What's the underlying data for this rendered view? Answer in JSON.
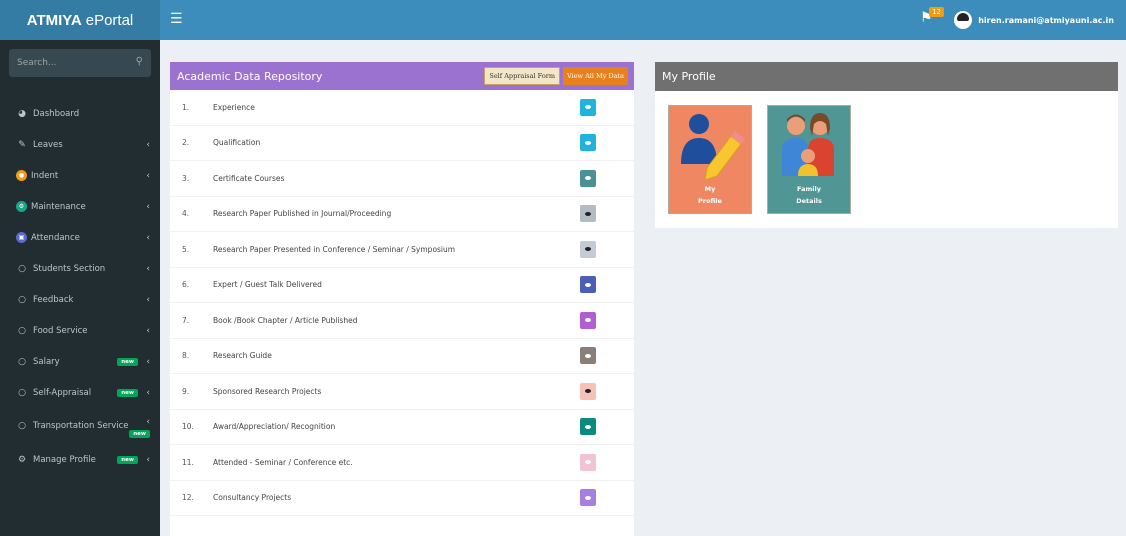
{
  "header": {
    "brand_bold": "ATMIYA",
    "brand_rest": "ePortal",
    "notification_count": "12",
    "user_email": "hiren.ramani@atmiyauni.ac.in"
  },
  "sidebar": {
    "search_placeholder": "Search...",
    "items": [
      {
        "label": "Dashboard",
        "icon": "dashboard-icon"
      },
      {
        "label": "Leaves",
        "icon": "edit-icon"
      },
      {
        "label": "Indent",
        "icon": "indent-icon"
      },
      {
        "label": "Maintenance",
        "icon": "maintenance-icon"
      },
      {
        "label": "Attendance",
        "icon": "attendance-icon"
      },
      {
        "label": "Students Section",
        "icon": "circle-icon"
      },
      {
        "label": "Feedback",
        "icon": "circle-icon"
      },
      {
        "label": "Food Service",
        "icon": "circle-icon"
      },
      {
        "label": "Salary",
        "icon": "circle-icon",
        "badge": "new"
      },
      {
        "label": "Self-Appraisal",
        "icon": "circle-icon",
        "badge": "new"
      },
      {
        "label": "Transportation Service",
        "icon": "circle-icon",
        "badge": "new"
      },
      {
        "label": "Manage Profile",
        "icon": "cogs-icon",
        "badge": "new"
      }
    ]
  },
  "academic": {
    "title": "Academic Data Repository",
    "self_appraisal_label": "Self Appraisal Form",
    "view_all_label": "View All My Data",
    "rows": [
      {
        "num": "1.",
        "label": "Experience",
        "color": "#1fb4e0"
      },
      {
        "num": "2.",
        "label": "Qualification",
        "color": "#1fb4e0"
      },
      {
        "num": "3.",
        "label": "Certificate Courses",
        "color": "#4a9095"
      },
      {
        "num": "4.",
        "label": "Research Paper Published in Journal/Proceeding",
        "color": "#b3bcc4"
      },
      {
        "num": "5.",
        "label": "Research Paper Presented in Conference / Seminar / Symposium",
        "color": "#c5cbd6"
      },
      {
        "num": "6.",
        "label": "Expert / Guest Talk Delivered",
        "color": "#4b5fb8"
      },
      {
        "num": "7.",
        "label": "Book /Book Chapter / Article Published",
        "color": "#b05fd3"
      },
      {
        "num": "8.",
        "label": "Research Guide",
        "color": "#8a7f78"
      },
      {
        "num": "9.",
        "label": "Sponsored Research Projects",
        "color": "#f5c2b8"
      },
      {
        "num": "10.",
        "label": "Award/Appreciation/ Recognition",
        "color": "#0b8a80"
      },
      {
        "num": "11.",
        "label": "Attended - Seminar / Conference etc.",
        "color": "#f1c3d3"
      },
      {
        "num": "12.",
        "label": "Consultancy Projects",
        "color": "#a77fe0"
      }
    ]
  },
  "profile": {
    "title": "My Profile",
    "tiles": [
      {
        "line1": "My",
        "line2": "Profile",
        "color": "#f08763"
      },
      {
        "line1": "Family",
        "line2": "Details",
        "color": "#4f9694"
      }
    ]
  }
}
